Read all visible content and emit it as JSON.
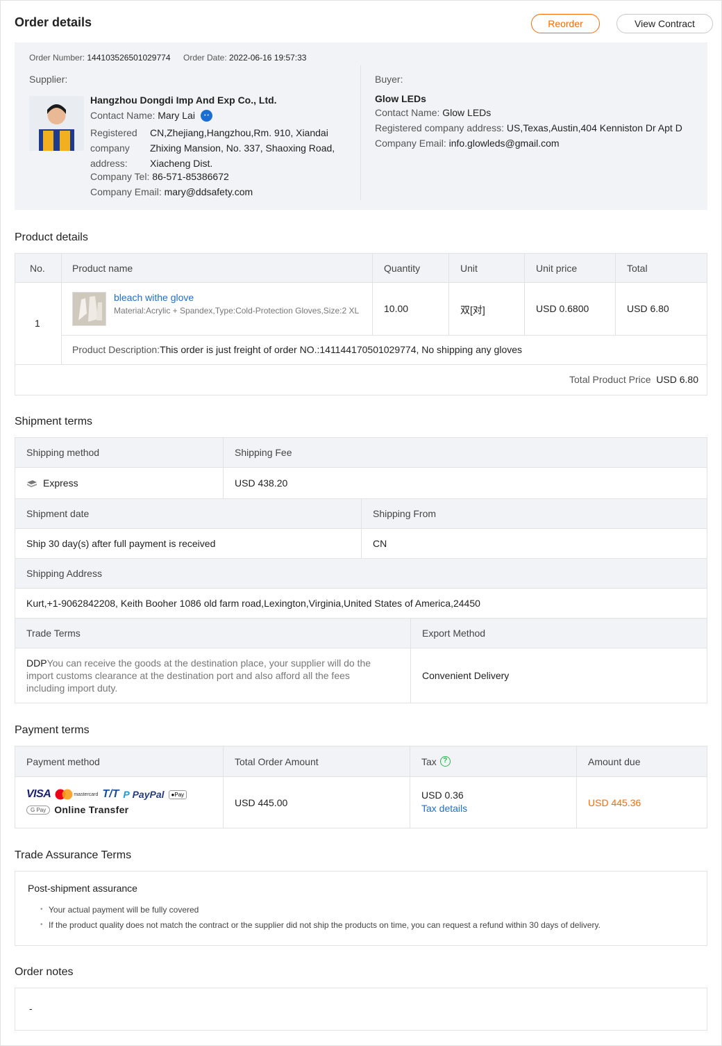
{
  "header": {
    "title": "Order details",
    "reorder_label": "Reorder",
    "view_contract_label": "View Contract"
  },
  "order": {
    "number_label": "Order Number:",
    "number": "144103526501029774",
    "date_label": "Order Date:",
    "date": "2022-06-16 19:57:33"
  },
  "supplier": {
    "section_label": "Supplier:",
    "name": "Hangzhou Dongdi Imp And Exp Co., Ltd.",
    "contact_label": "Contact Name:",
    "contact": "Mary Lai",
    "address_label_1": "Registered",
    "address_label_2": "company",
    "address_label_3": "address:",
    "address_line_1": "CN,Zhejiang,Hangzhou,Rm. 910, Xiandai",
    "address_line_2": "Zhixing Mansion, No. 337, Shaoxing Road,",
    "address_line_3": "Xiacheng Dist.",
    "tel_label": "Company Tel:",
    "tel": "86-571-85386672",
    "email_label": "Company Email:",
    "email": "mary@ddsafety.com",
    "chat_icon": "chat-bubble-icon"
  },
  "buyer": {
    "section_label": "Buyer:",
    "name": "Glow LEDs",
    "contact_label": "Contact Name:",
    "contact": "Glow LEDs",
    "address_label": "Registered company address:",
    "address": "US,Texas,Austin,404 Kenniston Dr Apt D",
    "email_label": "Company Email:",
    "email": "info.glowleds@gmail.com"
  },
  "product": {
    "section_title": "Product details",
    "columns": [
      "No.",
      "Product name",
      "Quantity",
      "Unit",
      "Unit price",
      "Total"
    ],
    "row": {
      "no": "1",
      "name": "bleach withe glove",
      "attrs": "Material:Acrylic + Spandex,Type:Cold-Protection Gloves,Size:2 XL",
      "quantity": "10.00",
      "unit": "双[对]",
      "unit_price": "USD 0.6800",
      "total": "USD 6.80"
    },
    "description_label": "Product Description:",
    "description": "This order is just freight of order NO.:141144170501029774, No shipping any gloves",
    "total_label": "Total Product Price",
    "total_value": "USD 6.80"
  },
  "shipment": {
    "section_title": "Shipment terms",
    "method_label": "Shipping method",
    "fee_label": "Shipping Fee",
    "method": "Express",
    "fee": "USD 438.20",
    "date_label": "Shipment date",
    "from_label": "Shipping From",
    "date": "Ship 30 day(s) after full payment is received",
    "from": "CN",
    "address_label": "Shipping Address",
    "address": "Kurt,+1-9062842208, Keith Booher 1086 old farm road,Lexington,Virginia,United States of America,24450",
    "trade_terms_label": "Trade Terms",
    "export_label": "Export Method",
    "trade_code": "DDP",
    "trade_desc_1": "You can receive the goods at the destination place, your supplier will do the",
    "trade_desc_2": "import customs clearance at the destination port and also afford all the fees",
    "trade_desc_3": "including import duty.",
    "export_method": "Convenient Delivery"
  },
  "payment": {
    "section_title": "Payment terms",
    "method_label": "Payment method",
    "total_label": "Total Order Amount",
    "tax_label": "Tax",
    "due_label": "Amount due",
    "methods": {
      "visa": "VISA",
      "mastercard": "mastercard",
      "tt": "T/T",
      "paypal": "PayPal",
      "applepay": "Pay",
      "gpay": "G Pay",
      "online": "Online Transfer"
    },
    "total": "USD 445.00",
    "tax": "USD 0.36",
    "tax_link": "Tax details",
    "due": "USD 445.36",
    "accent": "#ff6a00"
  },
  "assurance": {
    "section_title": "Trade Assurance Terms",
    "heading": "Post-shipment assurance",
    "items": [
      "Your actual payment will be fully covered",
      "If the product quality does not match the contract or the supplier did not ship the products on time, you can request a refund within 30 days of delivery."
    ]
  },
  "notes": {
    "section_title": "Order notes",
    "value": "-"
  }
}
